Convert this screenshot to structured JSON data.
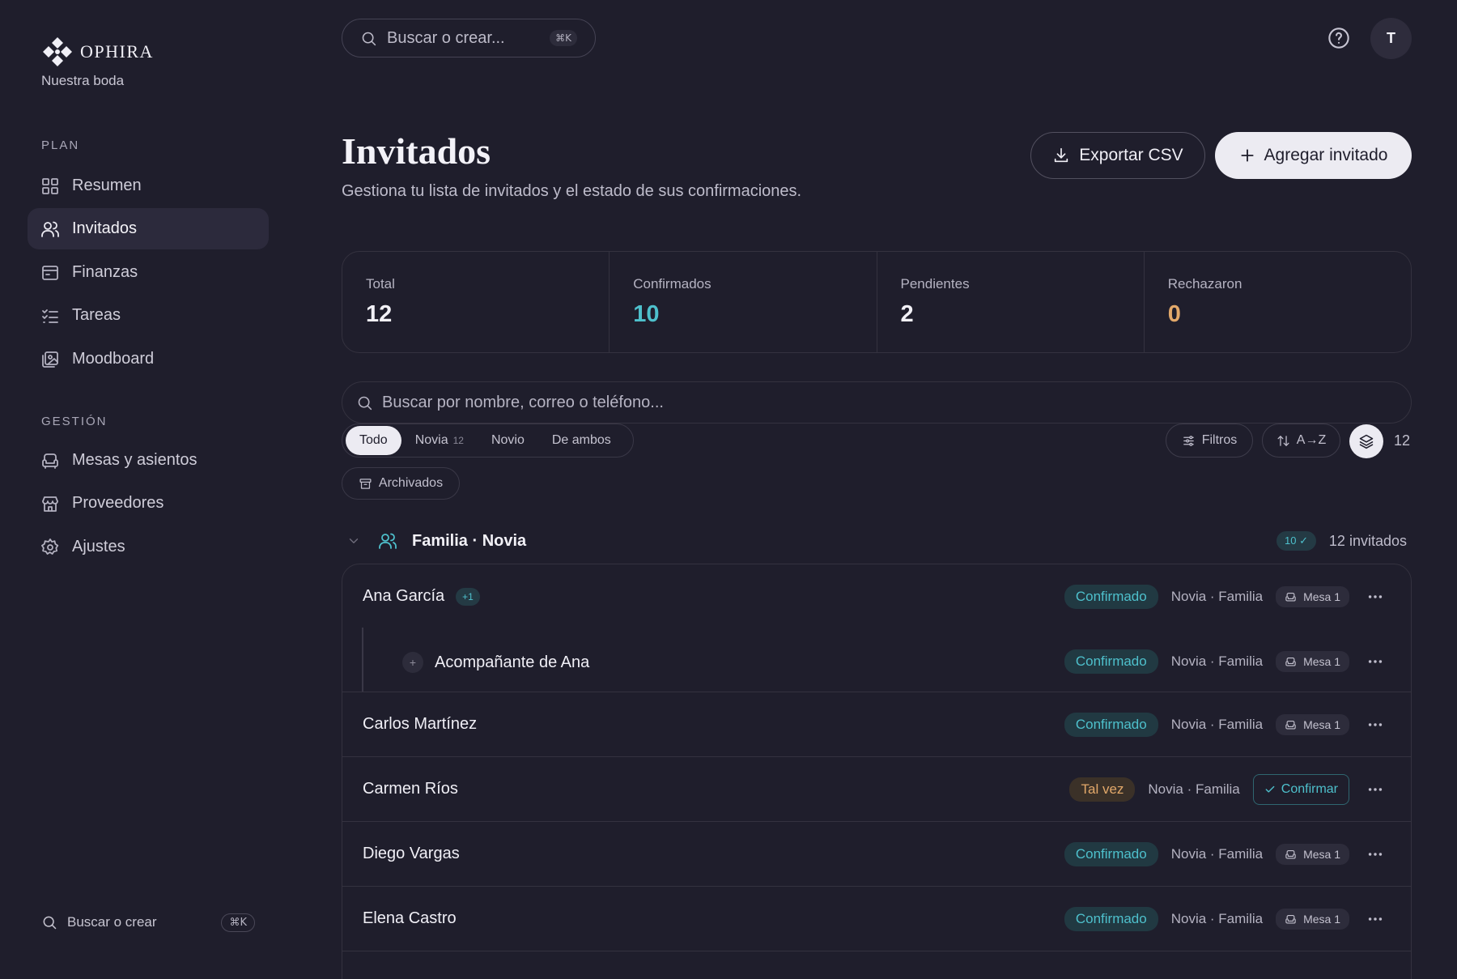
{
  "brand": {
    "name": "OPHIRA",
    "subtitle": "Nuestra boda"
  },
  "sidebar": {
    "sections": [
      {
        "label": "PLAN",
        "items": [
          {
            "label": "Resumen",
            "icon": "grid-icon"
          },
          {
            "label": "Invitados",
            "icon": "users-icon",
            "active": true
          },
          {
            "label": "Finanzas",
            "icon": "wallet-icon"
          },
          {
            "label": "Tareas",
            "icon": "checklist-icon"
          },
          {
            "label": "Moodboard",
            "icon": "image-board-icon"
          }
        ]
      },
      {
        "label": "GESTIÓN",
        "items": [
          {
            "label": "Mesas y asientos",
            "icon": "armchair-icon"
          },
          {
            "label": "Proveedores",
            "icon": "store-icon"
          },
          {
            "label": "Ajustes",
            "icon": "gear-icon"
          }
        ]
      }
    ],
    "search": {
      "label": "Buscar o crear",
      "shortcut": "⌘K"
    }
  },
  "topbar": {
    "search_placeholder": "Buscar o crear...",
    "shortcut": "⌘K",
    "avatar_initial": "T"
  },
  "header": {
    "title": "Invitados",
    "subtitle": "Gestiona tu lista de invitados y el estado de sus confirmaciones.",
    "export_label": "Exportar CSV",
    "add_label": "Agregar invitado"
  },
  "stats": [
    {
      "label": "Total",
      "value": "12",
      "color": "#f2f1f7"
    },
    {
      "label": "Confirmados",
      "value": "10",
      "color": "#4ec0cc"
    },
    {
      "label": "Pendientes",
      "value": "2",
      "color": "#f2f1f7"
    },
    {
      "label": "Rechazaron",
      "value": "0",
      "color": "#e2a86a"
    }
  ],
  "filters": {
    "search_placeholder": "Buscar por nombre, correo o teléfono...",
    "tabs": [
      {
        "label": "Todo",
        "count": "",
        "active": true
      },
      {
        "label": "Novia",
        "count": "12"
      },
      {
        "label": "Novio",
        "count": ""
      },
      {
        "label": "De ambos",
        "count": ""
      }
    ],
    "filters_label": "Filtros",
    "sort_label": "A→Z",
    "total": "12",
    "archived_label": "Archivados"
  },
  "group": {
    "title": "Familia · Novia",
    "confirmed_badge": "10 ✓",
    "count_label": "12 invitados"
  },
  "guests": [
    {
      "name": "Ana García",
      "plus": "+1",
      "status": "Confirmado",
      "status_type": "ok",
      "meta": "Novia · Familia",
      "table": "Mesa 1",
      "sub": false
    },
    {
      "name": "Acompañante de Ana",
      "sub_marker": "+",
      "status": "Confirmado",
      "status_type": "ok",
      "meta": "Novia · Familia",
      "table": "Mesa 1",
      "sub": true
    },
    {
      "name": "Carlos Martínez",
      "status": "Confirmado",
      "status_type": "ok",
      "meta": "Novia · Familia",
      "table": "Mesa 1",
      "sub": false
    },
    {
      "name": "Carmen Ríos",
      "status": "Tal vez",
      "status_type": "maybe",
      "meta": "Novia · Familia",
      "action": "Confirmar",
      "sub": false
    },
    {
      "name": "Diego Vargas",
      "status": "Confirmado",
      "status_type": "ok",
      "meta": "Novia · Familia",
      "table": "Mesa 1",
      "sub": false
    },
    {
      "name": "Elena Castro",
      "status": "Confirmado",
      "status_type": "ok",
      "meta": "Novia · Familia",
      "table": "Mesa 1",
      "sub": false
    }
  ]
}
